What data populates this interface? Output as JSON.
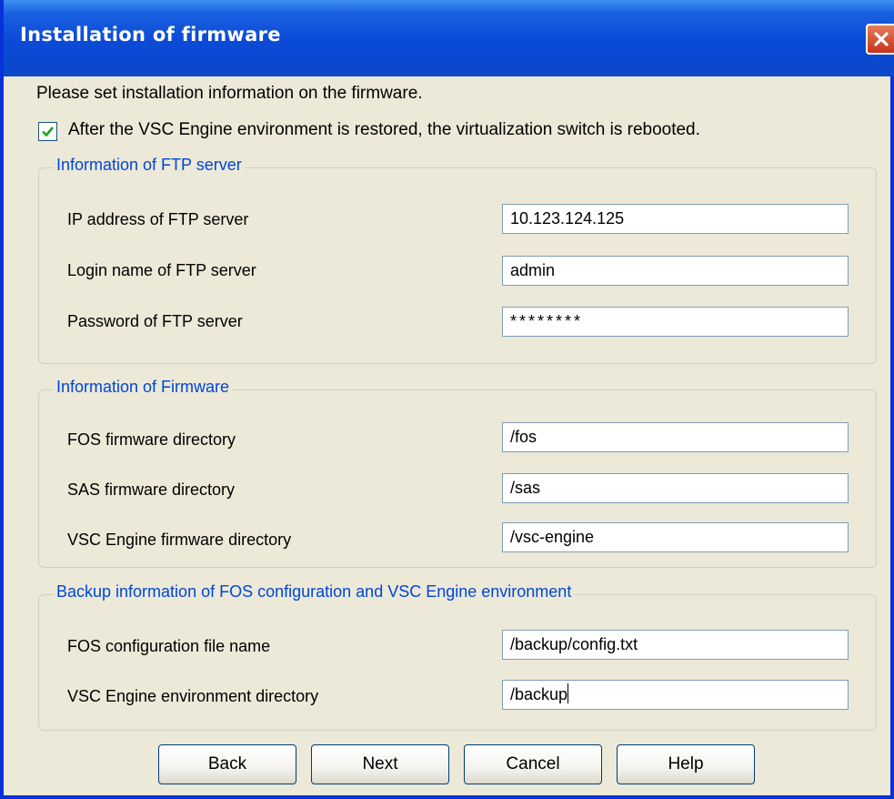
{
  "window": {
    "title": "Installation of firmware",
    "close_icon": "close-icon"
  },
  "intro_text": "Please set installation information on the firmware.",
  "reboot_option": {
    "checked": true,
    "label": "After the VSC Engine environment is restored, the virtualization switch is rebooted."
  },
  "ftp_group": {
    "legend": "Information of FTP server",
    "fields": [
      {
        "label": "IP address of FTP server",
        "value": "10.123.124.125"
      },
      {
        "label": "Login name of FTP server",
        "value": "admin"
      },
      {
        "label": "Password of FTP server",
        "value": "********"
      }
    ]
  },
  "firmware_group": {
    "legend": "Information of Firmware",
    "fields": [
      {
        "label": "FOS firmware directory",
        "value": "/fos"
      },
      {
        "label": "SAS firmware directory",
        "value": "/sas"
      },
      {
        "label": "VSC Engine firmware directory",
        "value": "/vsc-engine"
      }
    ]
  },
  "backup_group": {
    "legend": "Backup information of FOS configuration and VSC Engine environment",
    "fields": [
      {
        "label": "FOS configuration file name",
        "value": "/backup/config.txt"
      },
      {
        "label": "VSC Engine environment directory",
        "value": "/backup"
      }
    ]
  },
  "buttons": {
    "back": "Back",
    "next": "Next",
    "cancel": "Cancel",
    "help": "Help"
  },
  "colors": {
    "titlebar": "#0a4ad6",
    "legend_text": "#0046d5",
    "dialog_bg": "#ece9d8",
    "close_button": "#c6341a"
  }
}
